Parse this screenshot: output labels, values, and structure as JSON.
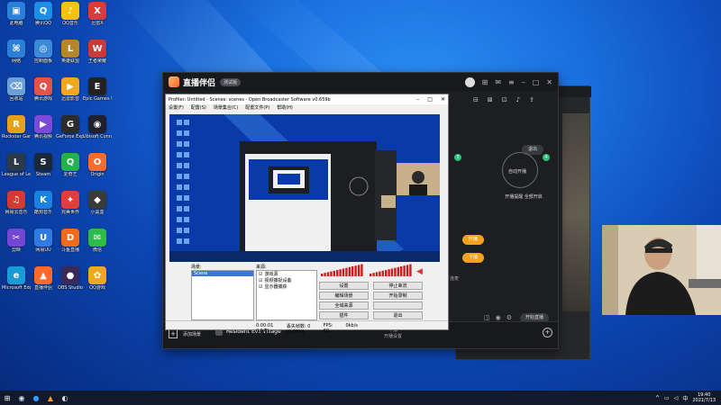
{
  "desktop": {
    "icons": [
      {
        "label": "此电脑",
        "glyph": "▣",
        "color": "#2a7fd8"
      },
      {
        "label": "腾讯QQ",
        "glyph": "Q",
        "color": "#1c8ee6"
      },
      {
        "label": "QQ音乐",
        "glyph": "♪",
        "color": "#f6c20a"
      },
      {
        "label": "迅雷X",
        "glyph": "X",
        "color": "#d93b3b"
      },
      {
        "label": "网络",
        "glyph": "⌘",
        "color": "#2a7fd8"
      },
      {
        "label": "控制面板",
        "glyph": "◎",
        "color": "#3a8ad8"
      },
      {
        "label": "英雄联盟",
        "glyph": "L",
        "color": "#b8862a"
      },
      {
        "label": "王者荣耀",
        "glyph": "W",
        "color": "#c93a3a"
      },
      {
        "label": "回收站",
        "glyph": "⌫",
        "color": "#6aa0d8"
      },
      {
        "label": "腾讯游戏",
        "glyph": "Q",
        "color": "#e4534a"
      },
      {
        "label": "迅雷影音",
        "glyph": "▶",
        "color": "#f0a81e"
      },
      {
        "label": "Epic Games Launcher",
        "glyph": "E",
        "color": "#222222"
      },
      {
        "label": "Rockstar Games",
        "glyph": "R",
        "color": "#e6a11b"
      },
      {
        "label": "腾讯视频",
        "glyph": "▶",
        "color": "#7b4adb"
      },
      {
        "label": "GeForce Experience",
        "glyph": "G",
        "color": "#2b2b2b"
      },
      {
        "label": "Ubisoft Connect",
        "glyph": "◉",
        "color": "#1f1f2e"
      },
      {
        "label": "League of Legends",
        "glyph": "L",
        "color": "#2a3a4a"
      },
      {
        "label": "Steam",
        "glyph": "S",
        "color": "#1b2838"
      },
      {
        "label": "爱奇艺",
        "glyph": "Q",
        "color": "#22b24c"
      },
      {
        "label": "Origin",
        "glyph": "O",
        "color": "#f56c2d"
      },
      {
        "label": "网易云音乐",
        "glyph": "♫",
        "color": "#d33a31"
      },
      {
        "label": "酷狗音乐",
        "glyph": "K",
        "color": "#1a82e2"
      },
      {
        "label": "完美世界",
        "glyph": "✦",
        "color": "#e23d3d"
      },
      {
        "label": "小黑盒",
        "glyph": "◆",
        "color": "#3a3a3a"
      },
      {
        "label": "剪映",
        "glyph": "✂",
        "color": "#7446d6"
      },
      {
        "label": "网易UU",
        "glyph": "U",
        "color": "#2d7be3"
      },
      {
        "label": "斗鱼直播",
        "glyph": "D",
        "color": "#f26a1b"
      },
      {
        "label": "微信",
        "glyph": "✉",
        "color": "#2dbb4a"
      },
      {
        "label": "Microsoft Edge",
        "glyph": "e",
        "color": "#1a9bd7"
      },
      {
        "label": "直播伴侣",
        "glyph": "▲",
        "color": "#ff6a2a"
      },
      {
        "label": "OBS Studio",
        "glyph": "●",
        "color": "#3a2a5a"
      },
      {
        "label": "QQ游戏",
        "glyph": "✿",
        "color": "#f0a81e"
      }
    ]
  },
  "zhibo": {
    "title": "直播伴侣",
    "badge": "测试版",
    "out_label": "退出",
    "pk_label": "自动开播",
    "pk_desc": "开播提醒 全部开启",
    "pill_a": "开播",
    "pill_b": "下播",
    "game_title": "Resident Evil Village",
    "add_scene": "添加场景",
    "bottom_hint": "下播\n开播设置",
    "counter_label": "连麦",
    "live_btn": "开始直播"
  },
  "obs": {
    "title": "Profiler: Untitled - Scenes: scenes - Open Broadcaster Software v0.659b",
    "menu": [
      "设置(F)",
      "配置(S)",
      "场景集合(C)",
      "配置文件(P)",
      "帮助(H)"
    ],
    "scenes_label": "场景:",
    "sources_label": "来源:",
    "scene_items": [
      "Scene"
    ],
    "source_items": [
      "游戏源",
      "视频捕捉设备",
      "显示器捕获"
    ],
    "buttons": [
      "设置",
      "停止串流",
      "编辑场景",
      "开始录制",
      "全域来源",
      "",
      "插件",
      "退出"
    ],
    "status_time": "0:00:01 (LIVE)",
    "status_dropped": "丢失帧数: 0 (0.00%)",
    "status_fps": "FPS: 60",
    "status_bitrate": "0kb/s"
  },
  "taskbar": {
    "time": "19:40",
    "date": "2021/7/13"
  }
}
